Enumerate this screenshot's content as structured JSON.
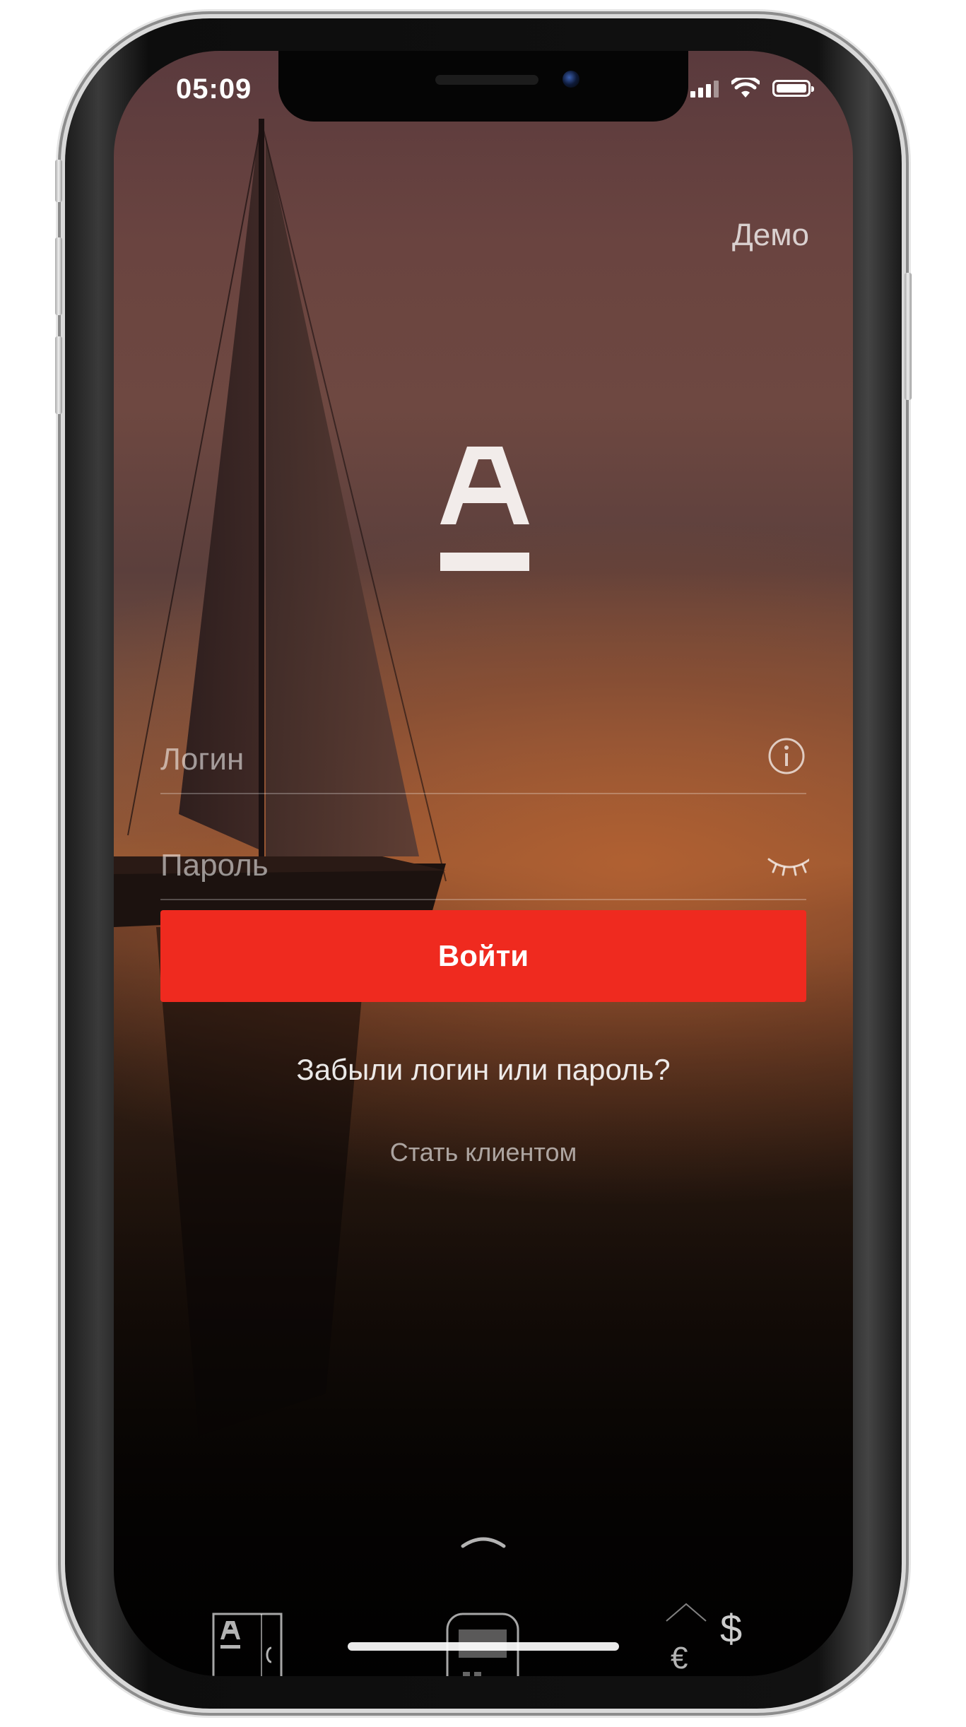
{
  "status_bar": {
    "time": "05:09"
  },
  "header": {
    "demo_label": "Демо"
  },
  "login_form": {
    "login_placeholder": "Логин",
    "password_placeholder": "Пароль",
    "login_value": "",
    "password_value": "",
    "submit_label": "Войти"
  },
  "links": {
    "forgot_label": "Забыли логин или пароль?",
    "become_client_label": "Стать клиентом"
  },
  "bottom_widgets": {
    "currency_dollar_symbol": "$",
    "currency_euro_symbol": "€"
  },
  "colors": {
    "accent_button": "#ef2a1f",
    "text_primary": "#ffffff"
  },
  "icons": {
    "logo": "alfa-bank-logo",
    "login_info": "info-icon",
    "password_visibility": "eye-closed-icon",
    "expand": "chevron-up-icon"
  }
}
